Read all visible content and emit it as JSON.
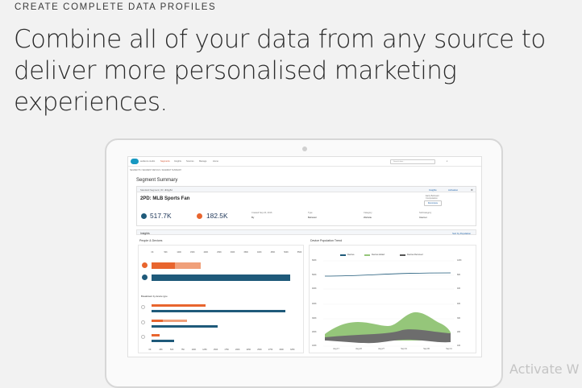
{
  "hero": {
    "eyebrow": "CREATE COMPLETE DATA PROFILES",
    "headline_line1": "Combine all of your data from any source to",
    "headline_line2": "deliver more personalised marketing experiences."
  },
  "app": {
    "logo_text": "audience studio",
    "nav": [
      "Segments",
      "Insights",
      "Sources",
      "Manage",
      "Home"
    ],
    "search_placeholder": "Search data...",
    "breadcrumb": "SEGMENTS  /  SEGMENT DETAILS  /  SEGMENT SUMMARY",
    "section_title": "Segment Summary",
    "segment": {
      "sub": "Standard Segment  |  ID: dbbjg5d",
      "insights_label": "Insights",
      "activation_label": "Activation",
      "name": "2PD: MLB Sports Fan",
      "early_behavior_label": "Early Behavior Computation",
      "button_label": "Recompute",
      "stat1": "517.7K",
      "stat2": "182.5K",
      "created_label": "Created Sep 20, 2016",
      "created_value": "By",
      "type_label": "Type",
      "type_value": "Behavior",
      "category_label": "Category",
      "category_value": "Website",
      "subcat_label": "SubCategory",
      "subcat_value": "Internet"
    },
    "insights": {
      "title": "Insights",
      "sort_label": "Sort by Population"
    },
    "people_devices": {
      "title": "People & Devices",
      "ticks": [
        "0K",
        "50K",
        "100K",
        "150K",
        "200K",
        "250K",
        "300K",
        "350K",
        "400K",
        "450K",
        "500K",
        "550K"
      ],
      "breakdown_title": "Breakdown by device type",
      "bottom_ticks": [
        "0K",
        "25K",
        "50K",
        "75K",
        "100K",
        "125K",
        "150K",
        "175K",
        "200K",
        "225K",
        "250K",
        "275K",
        "300K",
        "325K"
      ]
    },
    "device_trend": {
      "title": "Device Population Trend",
      "legend": [
        "Devices",
        "Devices Added",
        "Devices Removed"
      ],
      "y_left_top": [
        "600K",
        "500K",
        "400K"
      ],
      "y_right_top": [
        "120K",
        "80K",
        "40K"
      ],
      "y_left_bottom": [
        "400K",
        "300K",
        "200K",
        "100K"
      ],
      "y_right_bottom": [
        "40K",
        "30K",
        "20K",
        "10K"
      ],
      "x_ticks": [
        "Aug 17",
        "Aug 22",
        "Aug 27",
        "Sep 01",
        "Sep 06",
        "Sep 11"
      ]
    }
  },
  "watermark": "Activate W",
  "colors": {
    "orange": "#e8652e",
    "orange_light": "#f0a07a",
    "navy": "#1f5a7a",
    "green": "#95c67a",
    "gray_area": "#6d6d6d"
  }
}
